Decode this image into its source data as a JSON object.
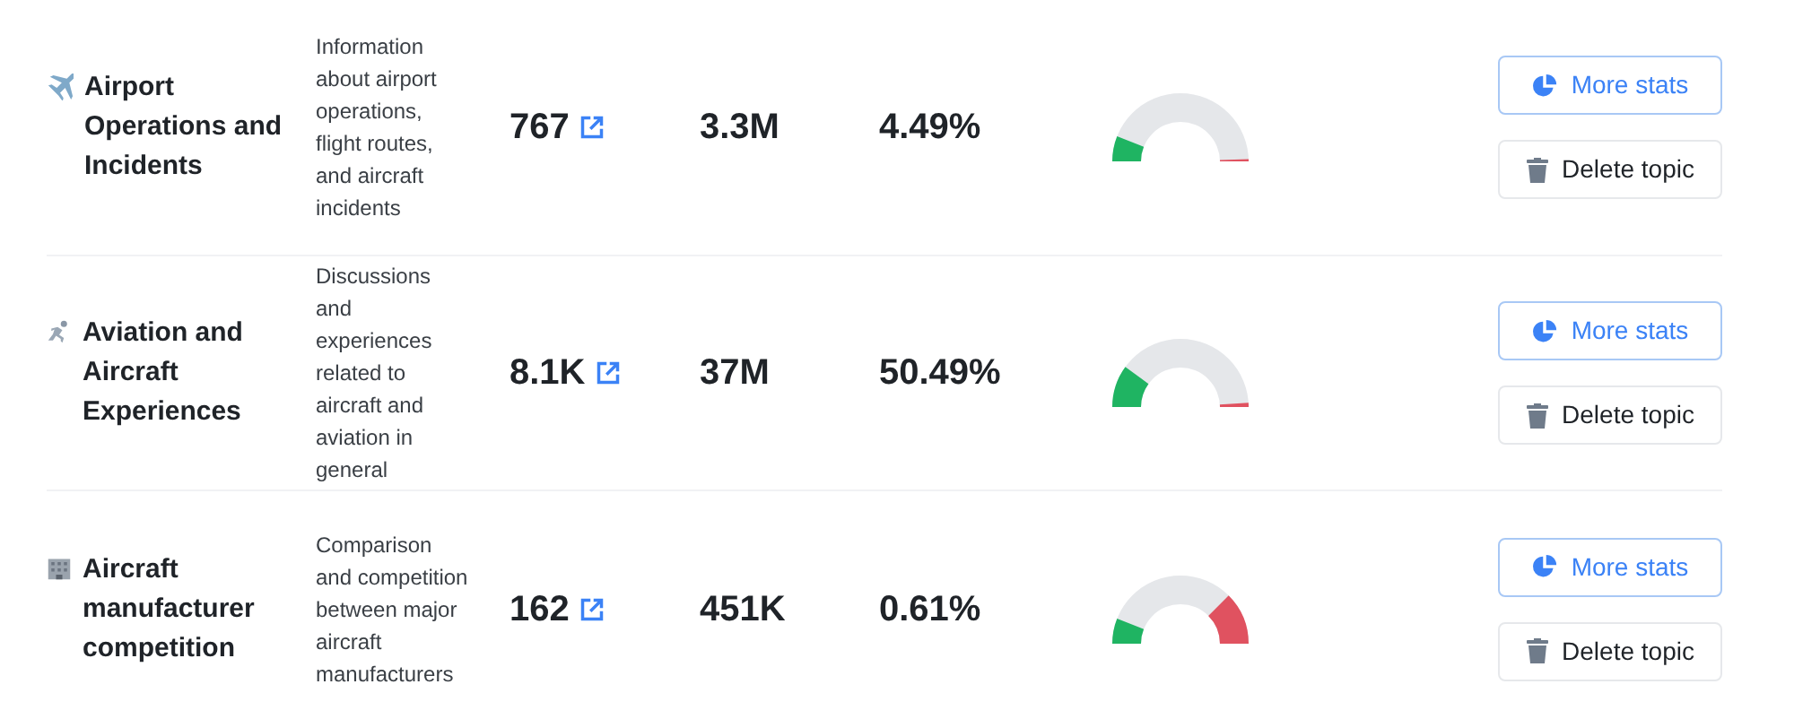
{
  "topics": [
    {
      "title": "Airport Operations and Incidents",
      "description": "Information about airport operations, flight routes, and aircraft incidents",
      "count": "767",
      "size": "3.3M",
      "percent": "4.49%",
      "buttons": [
        "More stats",
        "Delete topic"
      ]
    },
    {
      "title": "Aviation and Aircraft Experiences",
      "description": "Discussions and experiences related to aircraft and aviation in general",
      "count": "8.1K",
      "size": "37M",
      "percent": "50.49%",
      "buttons": [
        "More stats",
        "Delete topic"
      ]
    },
    {
      "title": "Aircraft manufacturer competition",
      "description": "Comparison and competition between major aircraft manufacturers",
      "count": "162",
      "size": "451K",
      "percent": "0.61%",
      "buttons": [
        "More stats",
        "Delete topic"
      ]
    }
  ]
}
